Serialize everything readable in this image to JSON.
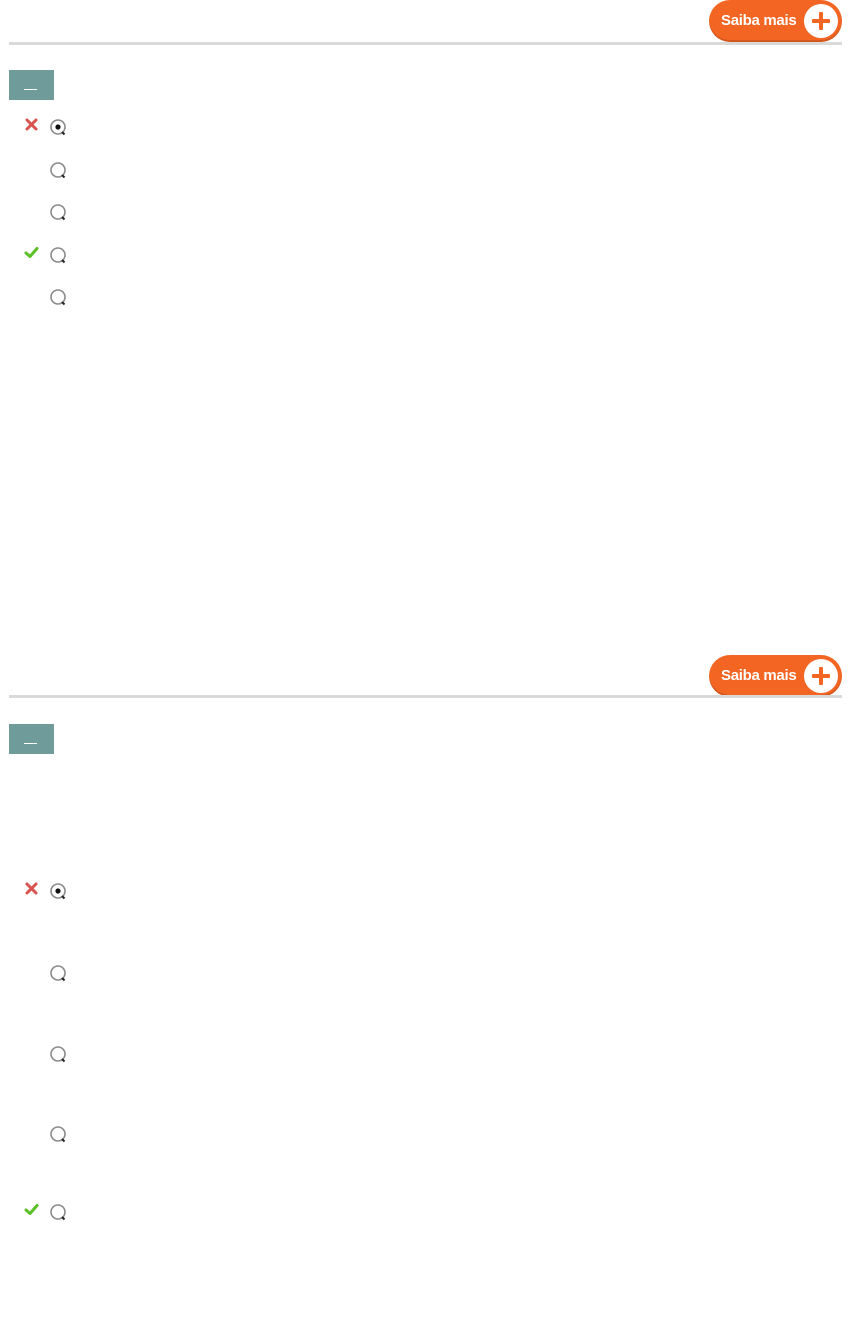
{
  "colors": {
    "accent_orange": "#f26522",
    "badge_teal": "#6f9c9a",
    "divider_gray": "#d9d9d9",
    "wrong_mark": "#d9534f",
    "correct_mark": "#5cc026"
  },
  "questions": [
    {
      "saiba_mais_label": "Saiba mais",
      "number_label": "",
      "options": [
        {
          "selected": true,
          "status": "wrong",
          "status_icon": "cross-icon",
          "text": ""
        },
        {
          "selected": false,
          "status": "none",
          "status_icon": "",
          "text": ""
        },
        {
          "selected": false,
          "status": "none",
          "status_icon": "",
          "text": ""
        },
        {
          "selected": false,
          "status": "correct",
          "status_icon": "check-icon",
          "text": ""
        },
        {
          "selected": false,
          "status": "none",
          "status_icon": "",
          "text": ""
        }
      ]
    },
    {
      "saiba_mais_label": "Saiba mais",
      "number_label": "",
      "options": [
        {
          "selected": true,
          "status": "wrong",
          "status_icon": "cross-icon",
          "text": ""
        },
        {
          "selected": false,
          "status": "none",
          "status_icon": "",
          "text": ""
        },
        {
          "selected": false,
          "status": "none",
          "status_icon": "",
          "text": ""
        },
        {
          "selected": false,
          "status": "none",
          "status_icon": "",
          "text": ""
        },
        {
          "selected": false,
          "status": "correct",
          "status_icon": "check-icon",
          "text": ""
        }
      ]
    }
  ]
}
